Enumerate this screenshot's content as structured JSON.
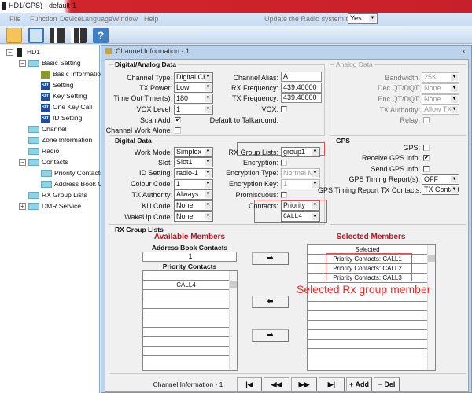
{
  "titlebar": {
    "title": "HD1(GPS)  -  default-1"
  },
  "menu": {
    "items": [
      "File",
      "Function",
      "Device",
      "Language",
      "Window",
      "Help"
    ],
    "update_label": "Update the Radio system time",
    "update_value": "Yes"
  },
  "toolbar": {
    "icons": [
      "open-folder-icon",
      "save-icon",
      "read-radio-icon",
      "write-radio-icon",
      "help-icon"
    ]
  },
  "tree": {
    "root": "HD1",
    "basic": "Basic Setting",
    "basic_info": "Basic Information",
    "setting": "Setting",
    "key_setting": "Key Setting",
    "one_key": "One Key Call",
    "id_setting": "ID Setting",
    "channel": "Channel",
    "zone": "Zone Information",
    "radio": "Radio",
    "contacts": "Contacts",
    "priority": "Priority Contacts",
    "address": "Address Book Co",
    "rxgroup": "RX Group Lists",
    "dmr": "DMR Service"
  },
  "window": {
    "title": "Channel Information - 1",
    "close": "x"
  },
  "da": {
    "title": "Digital/Analog Data",
    "channel_type": {
      "label": "Channel Type:",
      "value": "Digital CH"
    },
    "tx_power": {
      "label": "TX Power:",
      "value": "Low"
    },
    "tot": {
      "label": "Time Out Timer(s):",
      "value": "180"
    },
    "vox_level": {
      "label": "VOX Level:",
      "value": "1"
    },
    "scan_add": {
      "label": "Scan Add:",
      "checked": true
    },
    "work_alone": {
      "label": "Channel Work Alone:",
      "checked": false
    },
    "alias": {
      "label": "Channel Alias:",
      "value": "A"
    },
    "rx_freq": {
      "label": "RX Frequency:",
      "value": "439.40000"
    },
    "tx_freq": {
      "label": "TX Frequency:",
      "value": "439.40000"
    },
    "vox": {
      "label": "VOX:",
      "checked": false
    },
    "talkaround": {
      "label": "Default to Talkaround:"
    }
  },
  "analog": {
    "title": "Analog Data",
    "bandwidth": {
      "label": "Bandwidth:",
      "value": "25K"
    },
    "dec": {
      "label": "Dec QT/DQT:",
      "value": "None"
    },
    "enc": {
      "label": "Enc QT/DQT:",
      "value": "None"
    },
    "tx_auth": {
      "label": "TX Authority:",
      "value": "Allow TX"
    },
    "relay": {
      "label": "Relay:",
      "checked": false
    }
  },
  "digital": {
    "title": "Digital Data",
    "work_mode": {
      "label": "Work Mode:",
      "value": "Simplex"
    },
    "slot": {
      "label": "Slot:",
      "value": "Slot1"
    },
    "id_setting": {
      "label": "ID Setting:",
      "value": "radio-1"
    },
    "colour": {
      "label": "Colour Code:",
      "value": "1"
    },
    "tx_auth": {
      "label": "TX Authority:",
      "value": "Always"
    },
    "kill": {
      "label": "Kill Code:",
      "value": "None"
    },
    "wakeup": {
      "label": "WakeUp Code:",
      "value": "None"
    },
    "rx_group": {
      "label": "RX Group Lists:",
      "value": "group1"
    },
    "encryption": {
      "label": "Encryption:",
      "checked": false
    },
    "enc_type": {
      "label": "Encryption Type:",
      "value": "Normal Moc"
    },
    "enc_key": {
      "label": "Encryption Key:",
      "value": "1"
    },
    "promiscuous": {
      "label": "Promiscuous:",
      "checked": false
    },
    "contacts": {
      "label": "Contacts:",
      "value": "Priority",
      "value2": "CALL4"
    }
  },
  "gps": {
    "title": "GPS",
    "gps": {
      "label": "GPS:",
      "checked": false
    },
    "receive": {
      "label": "Receive GPS Info:",
      "checked": true
    },
    "send": {
      "label": "Send GPS Info:",
      "checked": false
    },
    "timing": {
      "label": "GPS Timing Report(s):",
      "value": "OFF"
    },
    "tx_contacts": {
      "label": "GPS Timing Report TX Contacts:",
      "value": "TX Contact"
    }
  },
  "rxg": {
    "title": "RX Group Lists",
    "available": "Available Members",
    "selected_title": "Selected Members",
    "address_label": "Address Book Contacts",
    "address_value": "1",
    "priority_label": "Priority Contacts",
    "priority_items": [
      "",
      "CALL4"
    ],
    "selected_header": "Selected",
    "selected_items": [
      "Priority Contacts: CALL1",
      "Priority Contacts: CALL2",
      "Priority Contacts: CALL3"
    ],
    "annotation": "Selected Rx group member",
    "arrow_right": "➡",
    "arrow_left": "⬅"
  },
  "nav": {
    "label": "Channel Information - 1",
    "first": "|◀",
    "prev": "◀◀",
    "next": "▶▶",
    "last": "▶|",
    "add": "+ Add",
    "del": "− Del"
  },
  "colors": {
    "annotation": "#e0302c",
    "highlight_box": "#e05050",
    "title_bar": "#d3242c"
  }
}
